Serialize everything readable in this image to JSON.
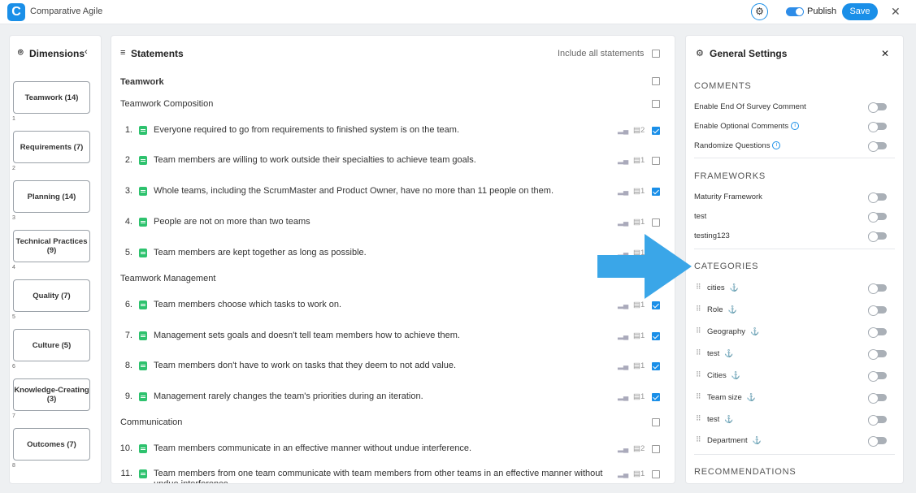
{
  "app": {
    "title": "Comparative Agile",
    "logo_letter": "C",
    "publish_label": "Publish",
    "save_label": "Save",
    "gear_icon": "gear-icon",
    "close_icon": "close-icon"
  },
  "dimensions": {
    "title": "Dimensions",
    "items": [
      {
        "label": "Teamwork (14)",
        "num": "1"
      },
      {
        "label": "Requirements (7)",
        "num": "2"
      },
      {
        "label": "Planning (14)",
        "num": "3"
      },
      {
        "label": "Technical Practices (9)",
        "num": "4"
      },
      {
        "label": "Quality (7)",
        "num": "5"
      },
      {
        "label": "Culture (5)",
        "num": "6"
      },
      {
        "label": "Knowledge-Creating (3)",
        "num": "7"
      },
      {
        "label": "Outcomes (7)",
        "num": "8"
      }
    ]
  },
  "statements": {
    "title": "Statements",
    "include_all_label": "Include all statements",
    "section": "Teamwork",
    "groups": [
      {
        "name": "Teamwork Composition"
      },
      {
        "name": "Teamwork Management"
      },
      {
        "name": "Communication"
      }
    ],
    "rows": [
      {
        "num": "1.",
        "text": "Everyone required to go from requirements to finished system is on the team.",
        "count": "2",
        "checked": true
      },
      {
        "num": "2.",
        "text": "Team members are willing to work outside their specialties to achieve team goals.",
        "count": "1",
        "checked": false
      },
      {
        "num": "3.",
        "text": "Whole teams, including the ScrumMaster and Product Owner, have no more than 11 people on them.",
        "count": "1",
        "checked": true
      },
      {
        "num": "4.",
        "text": "People are not on more than two teams",
        "count": "1",
        "checked": false
      },
      {
        "num": "5.",
        "text": "Team members are kept together as long as possible.",
        "count": "1",
        "checked": false
      },
      {
        "num": "6.",
        "text": "Team members choose which tasks to work on.",
        "count": "1",
        "checked": true
      },
      {
        "num": "7.",
        "text": "Management sets goals and doesn't tell team members how to achieve them.",
        "count": "1",
        "checked": true
      },
      {
        "num": "8.",
        "text": "Team members don't have to work on tasks that they deem to not add value.",
        "count": "1",
        "checked": true
      },
      {
        "num": "9.",
        "text": "Management rarely changes the team's priorities during an iteration.",
        "count": "1",
        "checked": true
      },
      {
        "num": "10.",
        "text": "Team members communicate in an effective manner without undue interference.",
        "count": "2",
        "checked": false
      },
      {
        "num": "11.",
        "text": "Team members from one team communicate with team members from other teams in an effective manner without undue interference.",
        "count": "1",
        "checked": false
      }
    ]
  },
  "settings": {
    "title": "General Settings",
    "comments_title": "COMMENTS",
    "comments": [
      "Enable End Of Survey Comment",
      "Enable Optional Comments",
      "Randomize Questions"
    ],
    "frameworks_title": "FRAMEWORKS",
    "frameworks": [
      "Maturity Framework",
      "test",
      "testing123"
    ],
    "categories_title": "CATEGORIES",
    "categories": [
      "cities",
      "Role",
      "Geography",
      "test",
      "Cities",
      "Team size",
      "test",
      "Department"
    ],
    "recommendations_title": "RECOMMENDATIONS"
  },
  "arrow_color": "#3aa6e8"
}
